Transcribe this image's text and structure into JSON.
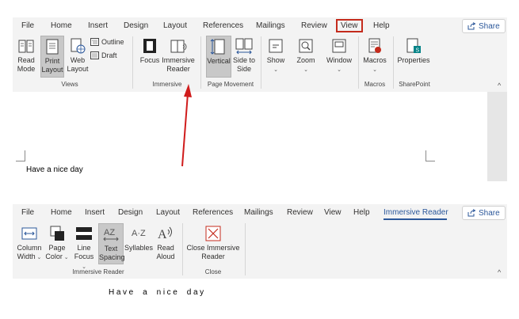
{
  "top_ribbon": {
    "tabs": [
      {
        "label": "File"
      },
      {
        "label": "Home"
      },
      {
        "label": "Insert"
      },
      {
        "label": "Design"
      },
      {
        "label": "Layout"
      },
      {
        "label": "References"
      },
      {
        "label": "Mailings"
      },
      {
        "label": "Review"
      },
      {
        "label": "View"
      },
      {
        "label": "Help"
      }
    ],
    "share_label": "Share",
    "buttons": {
      "read_mode": "Read Mode",
      "print_layout": "Print Layout",
      "web_layout": "Web Layout",
      "outline": "Outline",
      "draft": "Draft",
      "focus": "Focus",
      "immersive_reader": "Immersive Reader",
      "vertical": "Vertical",
      "side_to_side": "Side to Side",
      "show": "Show",
      "zoom": "Zoom",
      "window": "Window",
      "macros": "Macros",
      "properties": "Properties"
    },
    "groups": {
      "views": "Views",
      "immersive": "Immersive",
      "page_movement": "Page Movement",
      "macros": "Macros",
      "sharepoint": "SharePoint"
    },
    "collapse_icon": "^"
  },
  "document": {
    "text": "Have a nice day"
  },
  "bottom_ribbon": {
    "tabs": [
      {
        "label": "File"
      },
      {
        "label": "Home"
      },
      {
        "label": "Insert"
      },
      {
        "label": "Design"
      },
      {
        "label": "Layout"
      },
      {
        "label": "References"
      },
      {
        "label": "Mailings"
      },
      {
        "label": "Review"
      },
      {
        "label": "View"
      },
      {
        "label": "Help"
      },
      {
        "label": "Immersive Reader"
      }
    ],
    "share_label": "Share",
    "buttons": {
      "column_width": "Column Width",
      "page_color": "Page Color",
      "line_focus": "Line Focus",
      "text_spacing": "Text Spacing",
      "syllables": "Syllables",
      "read_aloud": "Read Aloud",
      "close_immersive_reader": "Close Immersive Reader"
    },
    "groups": {
      "immersive_reader": "Immersive Reader",
      "close": "Close"
    },
    "collapse_icon": "^"
  },
  "spaced_text": "Have a nice day",
  "colors": {
    "accent_blue": "#2b579a",
    "highlight_red": "#c42b1c",
    "ribbon_bg": "#f3f3f3",
    "arrow_red": "#d01c1c"
  }
}
